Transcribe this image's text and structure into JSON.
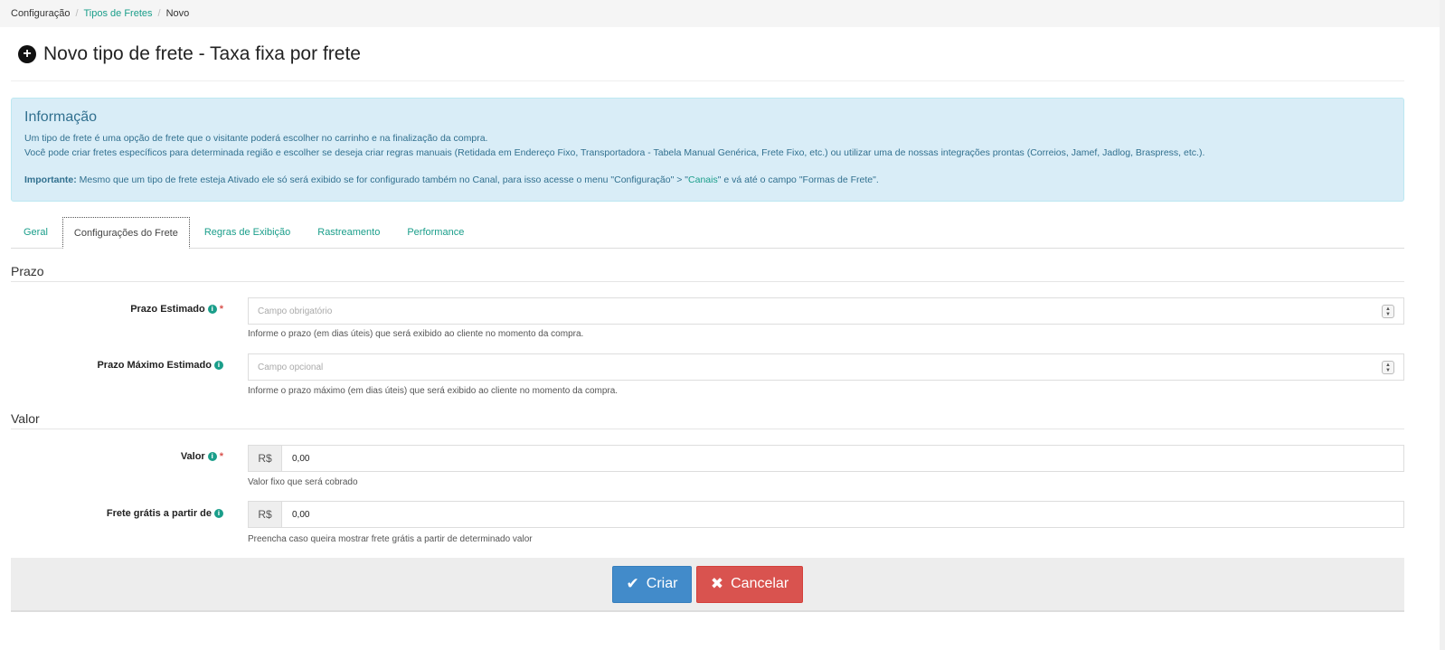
{
  "breadcrumb": {
    "items": [
      "Configuração",
      "Tipos de Fretes",
      "Novo"
    ],
    "separator": "/"
  },
  "page": {
    "title": "Novo tipo de frete - Taxa fixa por frete",
    "icon": "plus-circle-icon"
  },
  "info": {
    "heading": "Informação",
    "line1": "Um tipo de frete é uma opção de frete que o visitante poderá escolher no carrinho e na finalização da compra.",
    "line2": "Você pode criar fretes específicos para determinada região e escolher se deseja criar regras manuais (Retidada em Endereço Fixo, Transportadora - Tabela Manual Genérica, Frete Fixo, etc.) ou utilizar uma de nossas integrações prontas (Correios, Jamef, Jadlog, Braspress, etc.).",
    "important_label": "Importante:",
    "important_text_a": " Mesmo que um tipo de frete esteja Ativado ele só será exibido se for configurado também no Canal, para isso acesse o menu \"Configuração\" > \"",
    "important_link": "Canais",
    "important_text_b": "\" e vá até o campo \"Formas de Frete\"."
  },
  "tabs": [
    {
      "label": "Geral",
      "active": false
    },
    {
      "label": "Configurações do Frete",
      "active": true
    },
    {
      "label": "Regras de Exibição",
      "active": false
    },
    {
      "label": "Rastreamento",
      "active": false
    },
    {
      "label": "Performance",
      "active": false
    }
  ],
  "sections": {
    "prazo": "Prazo",
    "valor": "Valor"
  },
  "fields": {
    "prazo_estimado": {
      "label": "Prazo Estimado",
      "required": "*",
      "placeholder": "Campo obrigatório",
      "value": "",
      "help": "Informe o prazo (em dias úteis) que será exibido ao cliente no momento da compra."
    },
    "prazo_maximo": {
      "label": "Prazo Máximo Estimado",
      "placeholder": "Campo opcional",
      "value": "",
      "help": "Informe o prazo máximo (em dias úteis) que será exibido ao cliente no momento da compra."
    },
    "valor": {
      "label": "Valor",
      "required": "*",
      "currency": "R$",
      "value": "0,00",
      "help": "Valor fixo que será cobrado"
    },
    "frete_gratis": {
      "label": "Frete grátis a partir de",
      "currency": "R$",
      "value": "0,00",
      "help": "Preencha caso queira mostrar frete grátis a partir de determinado valor"
    }
  },
  "actions": {
    "create_label": "Criar",
    "cancel_label": "Cancelar"
  },
  "colors": {
    "link": "#1a9e8a",
    "info_bg": "#d9edf7",
    "info_text": "#31708f",
    "primary": "#428bca",
    "danger": "#d9534f"
  }
}
